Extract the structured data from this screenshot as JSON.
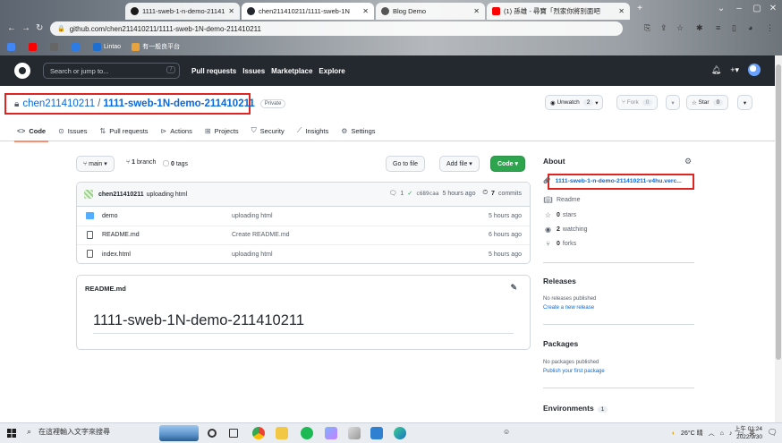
{
  "browser": {
    "tabs": [
      {
        "title": "1111-sweb-1-n-demo-211410",
        "icon_color": "#1a1a1a"
      },
      {
        "title": "chen211410211/1111-sweb-1N",
        "icon_color": "#24292f"
      },
      {
        "title": "Blog Demo",
        "icon_color": "#555555"
      },
      {
        "title": "(1) 孫雄 - 尋寶「烈家你將別面吧",
        "icon_color": "#ff0000"
      }
    ],
    "url": "github.com/chen211410211/1111-sweb-1N-demo-211410211",
    "bookmarks": [
      {
        "label": "",
        "color": "#4285f4"
      },
      {
        "label": "",
        "color": "#ff0000"
      },
      {
        "label": "",
        "color": "#666666"
      },
      {
        "label": "",
        "color": "#2d7be5"
      },
      {
        "label": "Lintao",
        "color": "#1f6fd1"
      },
      {
        "label": "有一般良平台",
        "color": "#e8a33c"
      }
    ]
  },
  "header": {
    "search_placeholder": "Search or jump to...",
    "search_key": "/",
    "nav": [
      "Pull requests",
      "Issues",
      "Marketplace",
      "Explore"
    ]
  },
  "repo": {
    "owner": "chen211410211",
    "name": "1111-sweb-1N-demo-211410211",
    "visibility": "Private",
    "unwatch_label": "Unwatch",
    "watch_count": "2",
    "fork_label": "Fork",
    "fork_count": "0",
    "star_label": "Star",
    "star_count": "0"
  },
  "tabs": [
    {
      "label": "Code",
      "icon": "code-icon"
    },
    {
      "label": "Issues",
      "icon": "issue-icon"
    },
    {
      "label": "Pull requests",
      "icon": "pull-request-icon"
    },
    {
      "label": "Actions",
      "icon": "play-icon"
    },
    {
      "label": "Projects",
      "icon": "table-icon"
    },
    {
      "label": "Security",
      "icon": "shield-icon"
    },
    {
      "label": "Insights",
      "icon": "graph-icon"
    },
    {
      "label": "Settings",
      "icon": "gear-icon"
    }
  ],
  "toolbar": {
    "branch": "main",
    "branch_count": "1",
    "branch_word": "branch",
    "tag_count": "0",
    "tag_word": "tags",
    "go_to_file": "Go to file",
    "add_file": "Add file",
    "code": "Code"
  },
  "commit": {
    "author": "chen211410211",
    "message": "uploading html",
    "comments": "1",
    "sha": "c689caa",
    "time": "5 hours ago",
    "commit_count": "7",
    "commit_word": "commits"
  },
  "files": [
    {
      "name": "demo",
      "type": "dir",
      "message": "uploading html",
      "time": "5 hours ago"
    },
    {
      "name": "README.md",
      "type": "file",
      "message": "Create README.md",
      "time": "6 hours ago"
    },
    {
      "name": "index.html",
      "type": "file",
      "message": "uploading html",
      "time": "5 hours ago"
    }
  ],
  "readme": {
    "filename": "README.md",
    "heading": "1111-sweb-1N-demo-211410211"
  },
  "about": {
    "title": "About",
    "homepage": "1111-sweb-1-n-demo-211410211-v4hu.verc...",
    "readme": "Readme",
    "stars_count": "0",
    "stars_word": "stars",
    "watching_count": "2",
    "watching_word": "watching",
    "forks_count": "0",
    "forks_word": "forks"
  },
  "releases": {
    "title": "Releases",
    "empty": "No releases published",
    "link": "Create a new release"
  },
  "packages": {
    "title": "Packages",
    "empty": "No packages published",
    "link": "Publish your first package"
  },
  "environments": {
    "title": "Environments",
    "count": "1"
  },
  "taskbar": {
    "search_placeholder": "在這裡輸入文字來搜尋",
    "weather": "26°C 晴",
    "ime": "英",
    "time": "上午 01:24",
    "date": "2022/9/30"
  },
  "colors": {
    "accent_blue": "#0969da",
    "code_green": "#2da44e",
    "highlight_red": "#e0241f",
    "header_dark": "#24292f"
  }
}
